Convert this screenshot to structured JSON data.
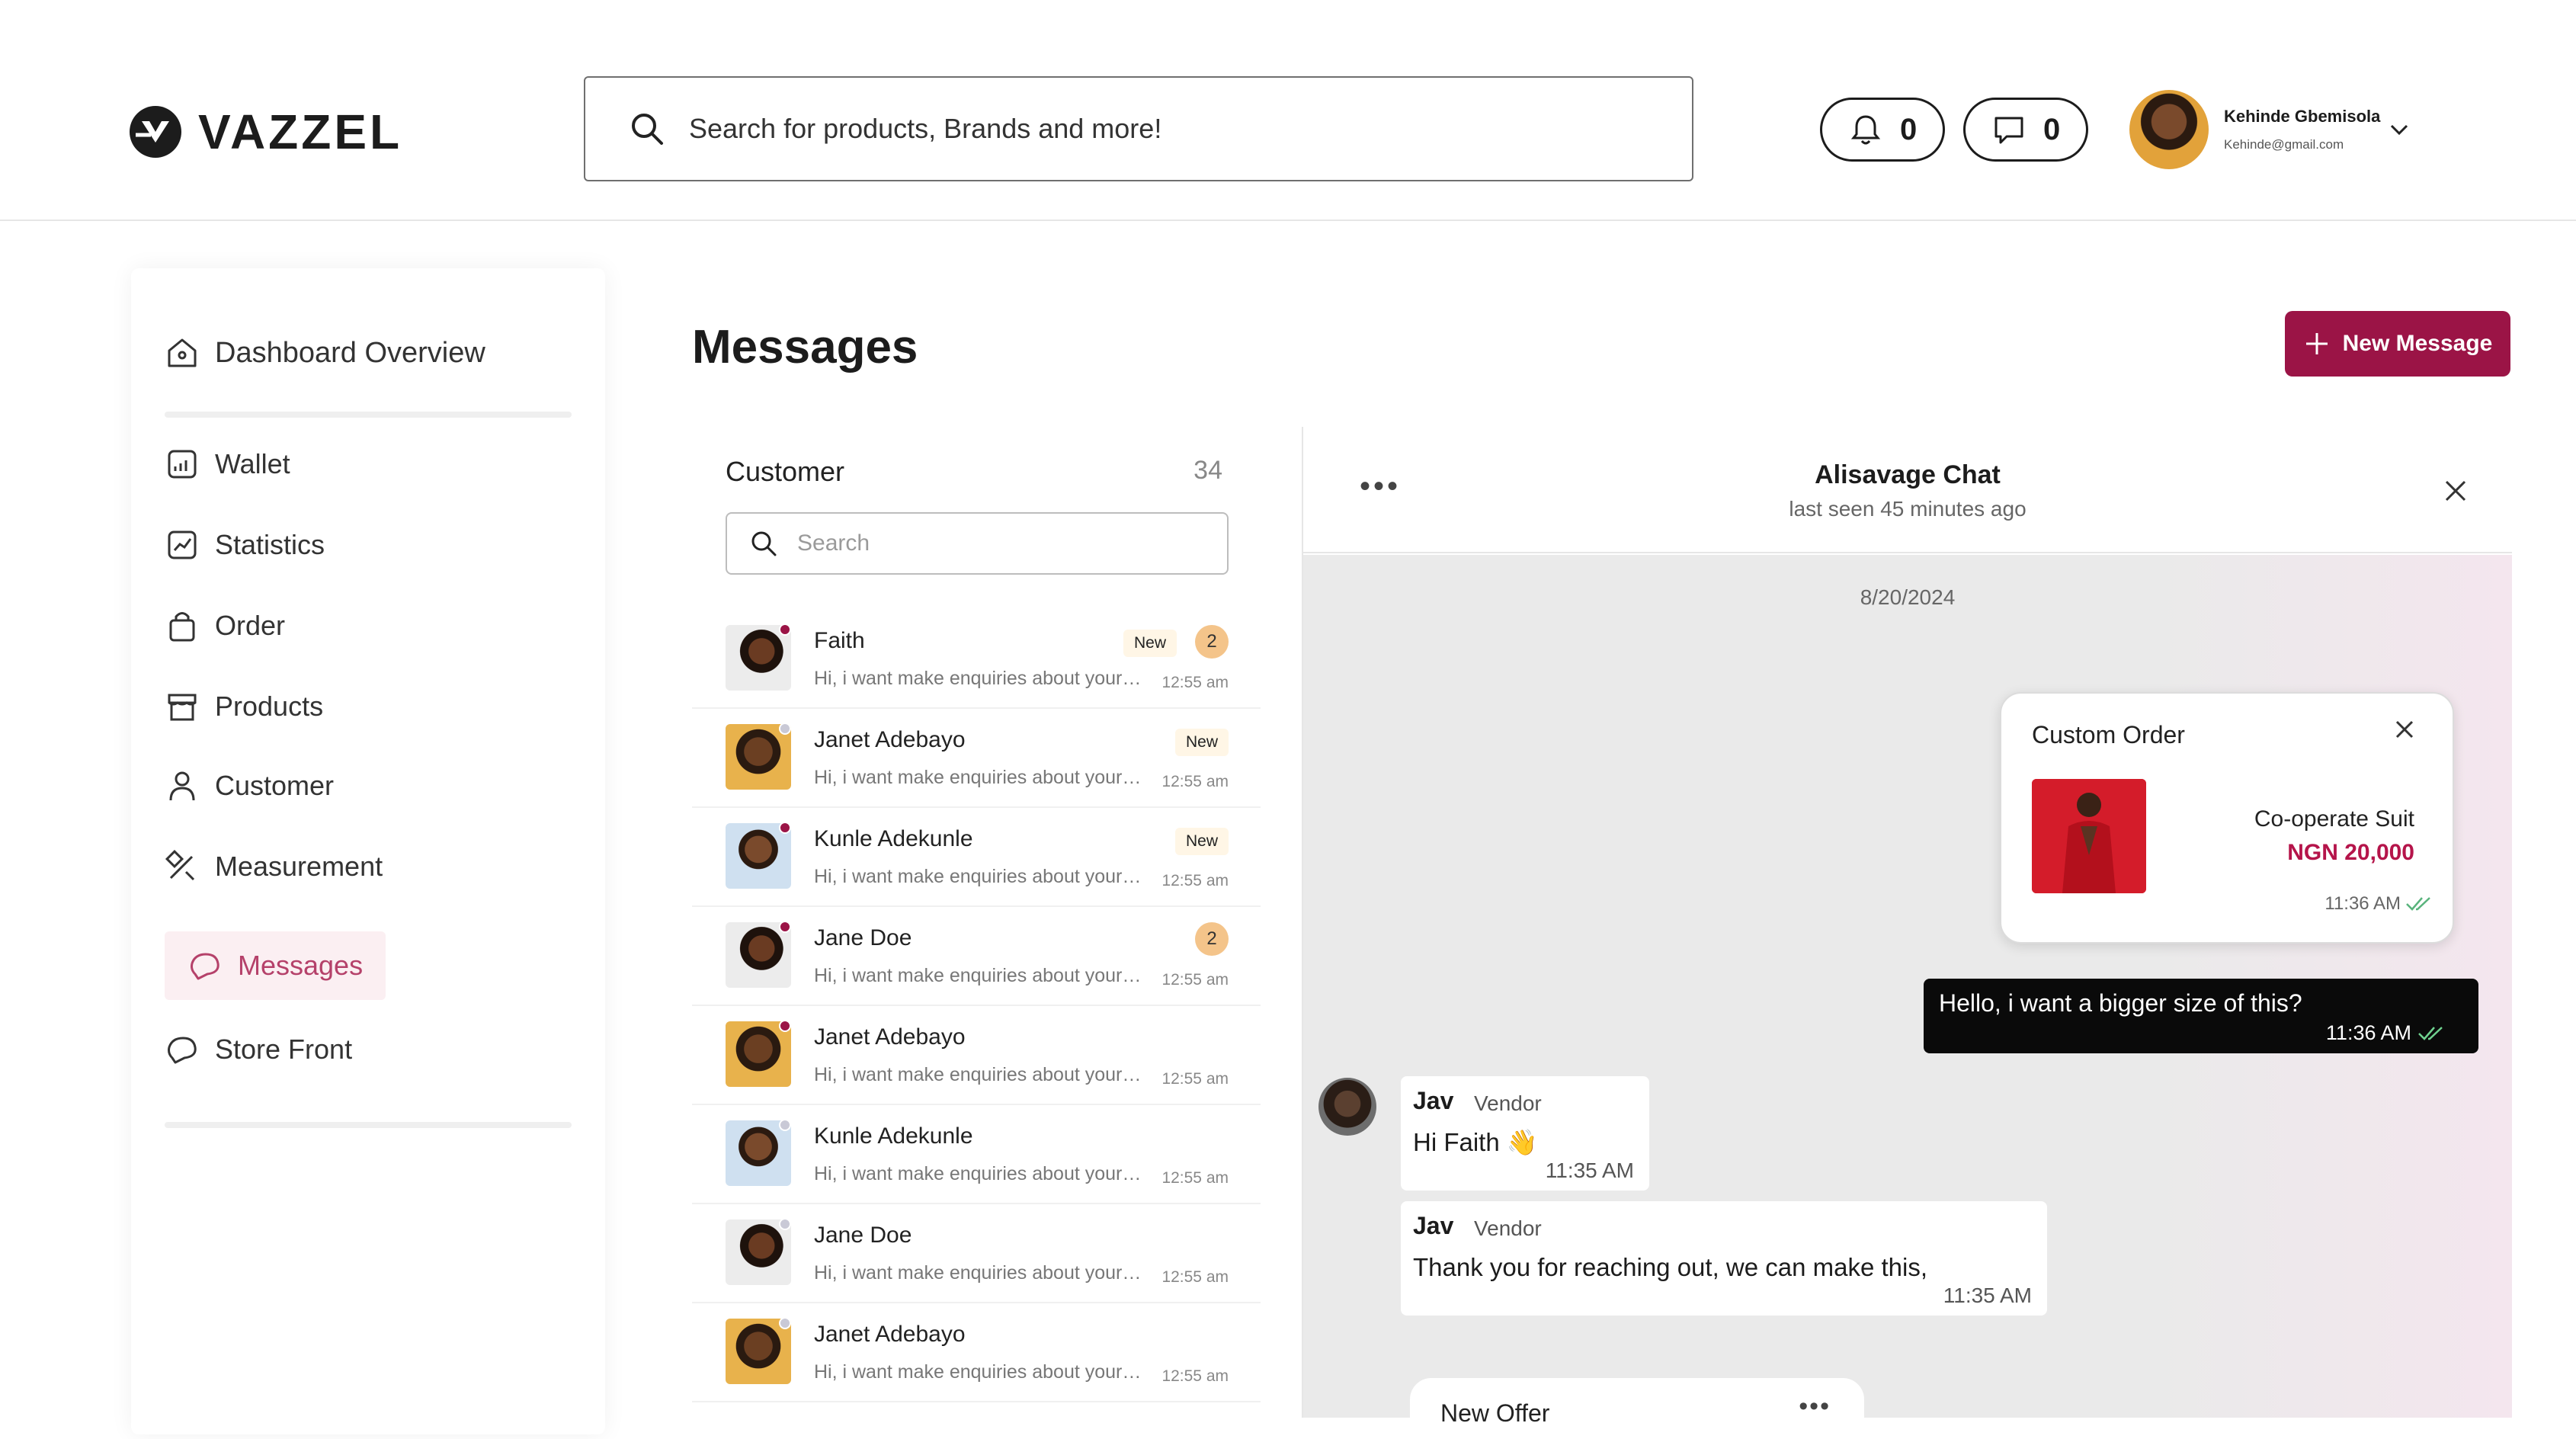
{
  "brand": {
    "name": "VAZZEL"
  },
  "search": {
    "placeholder": "Search for products, Brands and more!"
  },
  "header": {
    "notifications_count": "0",
    "messages_count": "0",
    "user_name": "Kehinde Gbemisola",
    "user_email": "Kehinde@gmail.com"
  },
  "sidebar": {
    "items": [
      {
        "label": "Dashboard Overview",
        "icon": "home-icon"
      },
      {
        "label": "Wallet",
        "icon": "wallet-icon"
      },
      {
        "label": "Statistics",
        "icon": "statistics-icon"
      },
      {
        "label": "Order",
        "icon": "bag-icon"
      },
      {
        "label": "Products",
        "icon": "store-icon"
      },
      {
        "label": "Customer",
        "icon": "user-icon"
      },
      {
        "label": "Measurement",
        "icon": "ruler-pencil-icon"
      },
      {
        "label": "Messages",
        "icon": "chat-icon",
        "active": true
      },
      {
        "label": "Store Front",
        "icon": "chat-icon"
      }
    ]
  },
  "page": {
    "title": "Messages",
    "new_message_label": "New Message"
  },
  "conversations": {
    "heading": "Customer",
    "count": "34",
    "search_placeholder": "Search",
    "items": [
      {
        "name": "Faith",
        "preview": "Hi, i want make enquiries about your products",
        "time": "12:55 am",
        "new": "New",
        "unread": "2",
        "online": true
      },
      {
        "name": "Janet Adebayo",
        "preview": "Hi, i want make enquiries about your products",
        "time": "12:55 am",
        "new": "New",
        "unread": "",
        "online": false
      },
      {
        "name": "Kunle Adekunle",
        "preview": "Hi, i want make enquiries about your products",
        "time": "12:55 am",
        "new": "New",
        "unread": "",
        "online": true
      },
      {
        "name": "Jane Doe",
        "preview": "Hi, i want make enquiries about your products",
        "time": "12:55 am",
        "new": "",
        "unread": "2",
        "online": true
      },
      {
        "name": "Janet Adebayo",
        "preview": "Hi, i want make enquiries about your products",
        "time": "12:55 am",
        "new": "",
        "unread": "",
        "online": true
      },
      {
        "name": "Kunle Adekunle",
        "preview": "Hi, i want make enquiries about your products",
        "time": "12:55 am",
        "new": "",
        "unread": "",
        "online": false
      },
      {
        "name": "Jane Doe",
        "preview": "Hi, i want make enquiries about your products",
        "time": "12:55 am",
        "new": "",
        "unread": "",
        "online": false
      },
      {
        "name": "Janet Adebayo",
        "preview": "Hi, i want make enquiries about your products",
        "time": "12:55 am",
        "new": "",
        "unread": "",
        "online": false
      }
    ]
  },
  "chat": {
    "title": "Alisavage Chat",
    "subtitle": "last seen 45 minutes ago",
    "date": "8/20/2024",
    "order_card": {
      "title": "Custom Order",
      "product_name": "Co-operate Suit",
      "price": "NGN 20,000",
      "time": "11:36 AM"
    },
    "sent_message": {
      "text": "Hello, i want a bigger size of this?",
      "time": "11:36 AM"
    },
    "vendor_messages": [
      {
        "name": "Jav",
        "role": "Vendor",
        "text": "Hi Faith 👋",
        "time": "11:35 AM"
      },
      {
        "name": "Jav",
        "role": "Vendor",
        "text": "Thank you for reaching out, we can make this,",
        "time": "11:35 AM"
      }
    ],
    "offer_title": "New Offer"
  },
  "colors": {
    "accent": "#9b1446",
    "active_bg": "#fbeff2",
    "unread_badge": "#f4c48a",
    "online_dot": "#9b1446",
    "offline_dot": "#c9c9d6"
  }
}
